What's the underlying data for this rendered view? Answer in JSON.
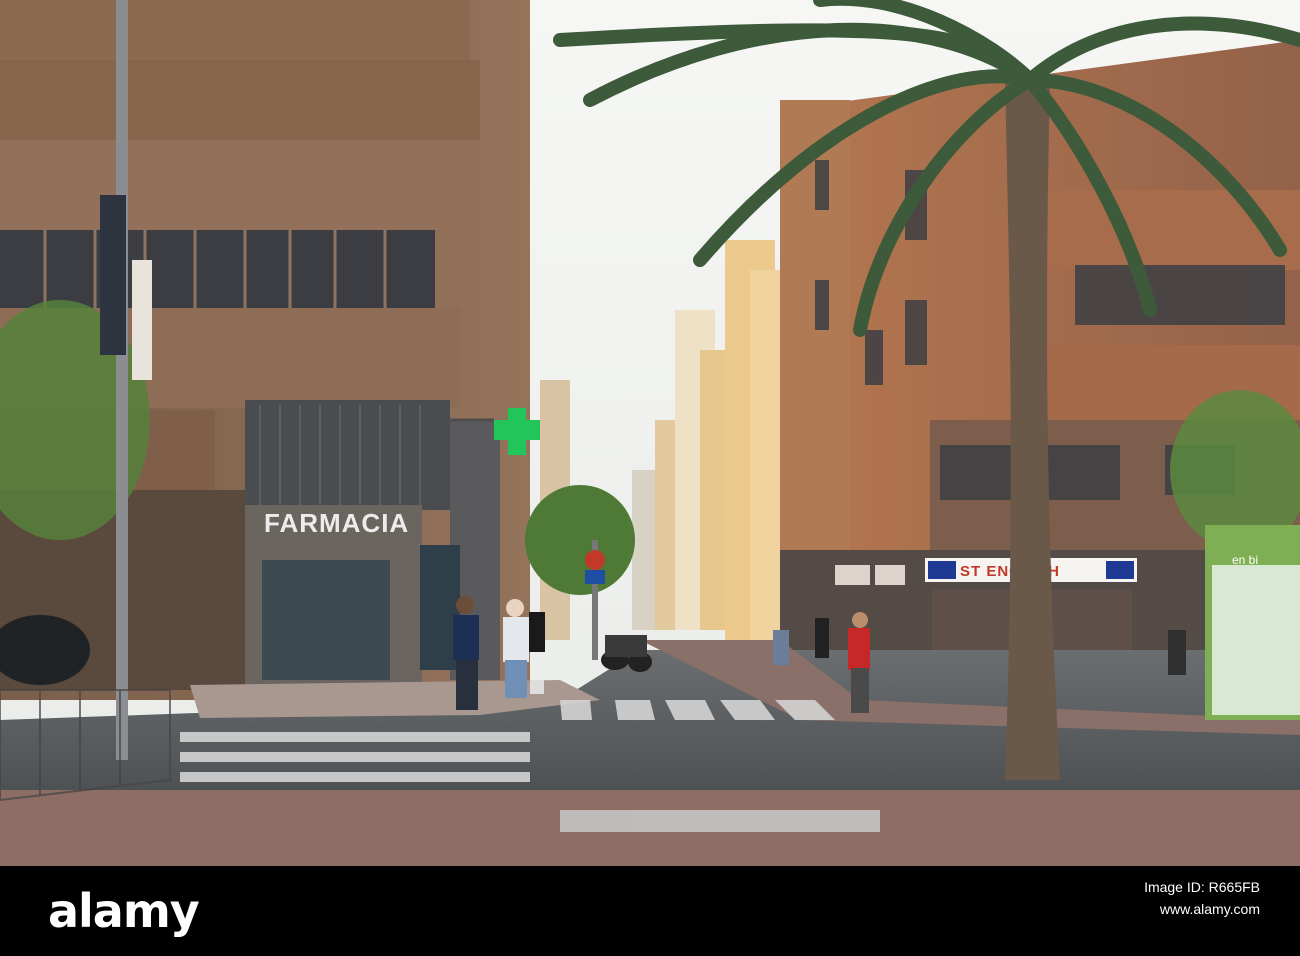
{
  "scene": {
    "pharmacy_sign": "FARMACIA",
    "english_shop_sign": "ST ENGLISH",
    "bike_map_sign": "en bi",
    "colors": {
      "sky": "#f4f5f3",
      "left_building": "#8a6c55",
      "right_building": "#a86e4f",
      "pharmacy_cross": "#22c55a",
      "road": "#52565a",
      "sidewalk": "#8c6b60"
    }
  },
  "footer": {
    "brand": "alamy",
    "line1": "Image ID: R665FB",
    "line2": "www.alamy.com",
    "image_id": "R665FB"
  }
}
